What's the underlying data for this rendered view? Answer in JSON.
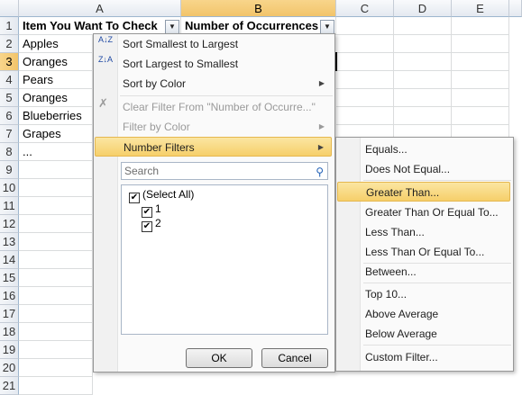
{
  "columns": [
    "A",
    "B",
    "C",
    "D",
    "E"
  ],
  "rows": [
    "1",
    "2",
    "3",
    "4",
    "5",
    "6",
    "7",
    "8",
    "9",
    "10",
    "11",
    "12",
    "13",
    "14",
    "15",
    "16",
    "17",
    "18",
    "19",
    "20",
    "21"
  ],
  "cells": {
    "A1": "Item You Want To Check",
    "B1": "Number of Occurrences",
    "A2": "Apples",
    "A3": "Oranges",
    "A4": "Pears",
    "A5": "Oranges",
    "A6": "Blueberries",
    "A7": "Grapes",
    "A8": "..."
  },
  "filter_button_glyph": "▼",
  "menu": {
    "sort_asc": "Sort Smallest to Largest",
    "sort_desc": "Sort Largest to Smallest",
    "sort_color": "Sort by Color",
    "clear_filter": "Clear Filter From \"Number of Occurre...\"",
    "filter_color": "Filter by Color",
    "number_filters": "Number Filters",
    "search_placeholder": "Search",
    "checklist": [
      "(Select All)",
      "1",
      "2"
    ],
    "ok": "OK",
    "cancel": "Cancel",
    "sort_asc_icon": "A↓Z",
    "sort_desc_icon": "Z↓A",
    "arrow": "▶"
  },
  "submenu": {
    "items": [
      "Equals...",
      "Does Not Equal...",
      "Greater Than...",
      "Greater Than Or Equal To...",
      "Less Than...",
      "Less Than Or Equal To...",
      "Between...",
      "Top 10...",
      "Above Average",
      "Below Average",
      "Custom Filter..."
    ]
  },
  "colors": {
    "highlight": "#f6cf6a",
    "header_selected": "#f2c46a"
  }
}
